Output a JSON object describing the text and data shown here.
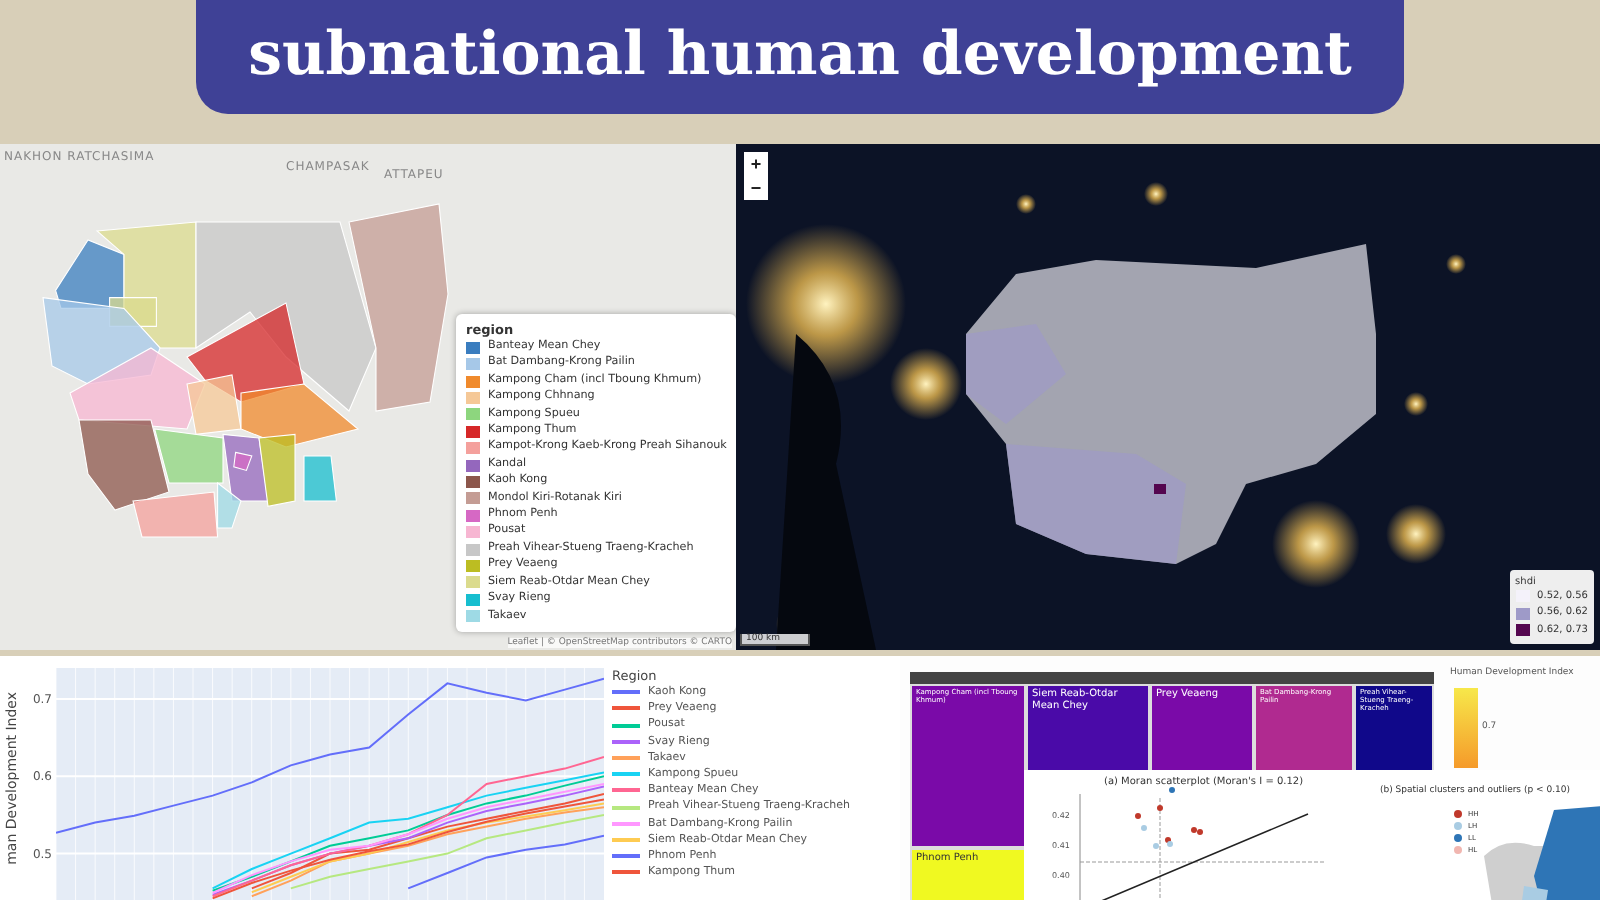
{
  "title": "subnational human development",
  "region_map": {
    "place_labels": [
      "NAKHON RATCHASIMA",
      "CHAMPASAK",
      "ATTAPEU"
    ],
    "legend": {
      "title": "region",
      "items": [
        {
          "label": "Banteay Mean Chey",
          "color": "#3a7dbf"
        },
        {
          "label": "Bat Dambang-Krong Pailin",
          "color": "#a6c8e8"
        },
        {
          "label": "Kampong Cham (incl Tboung Khmum)",
          "color": "#f08a2c"
        },
        {
          "label": "Kampong Chhnang",
          "color": "#f5c897"
        },
        {
          "label": "Kampong Spueu",
          "color": "#8dd67e"
        },
        {
          "label": "Kampong Thum",
          "color": "#d62728"
        },
        {
          "label": "Kampot-Krong Kaeb-Krong Preah Sihanouk",
          "color": "#f4a09c"
        },
        {
          "label": "Kandal",
          "color": "#9467bd"
        },
        {
          "label": "Kaoh Kong",
          "color": "#8c564b"
        },
        {
          "label": "Mondol Kiri-Rotanak Kiri",
          "color": "#c49c94"
        },
        {
          "label": "Phnom Penh",
          "color": "#d668c4"
        },
        {
          "label": "Pousat",
          "color": "#f7b6d2"
        },
        {
          "label": "Preah Vihear-Stueng Traeng-Kracheh",
          "color": "#c7c7c7"
        },
        {
          "label": "Prey Veaeng",
          "color": "#bcbd22"
        },
        {
          "label": "Siem Reab-Otdar Mean Chey",
          "color": "#dbdb8d"
        },
        {
          "label": "Svay Rieng",
          "color": "#17becf"
        },
        {
          "label": "Takaev",
          "color": "#9edae5"
        }
      ]
    },
    "attribution": "Leaflet | © OpenStreetMap contributors © CARTO"
  },
  "night_map": {
    "zoom_in": "+",
    "zoom_out": "−",
    "scale": "100 km",
    "legend": {
      "title": "shdi",
      "items": [
        {
          "label": "0.52, 0.56",
          "color": "#f4f2fa"
        },
        {
          "label": "0.56, 0.62",
          "color": "#9e9ac8"
        },
        {
          "label": "0.62, 0.73",
          "color": "#54064f"
        }
      ]
    }
  },
  "line_chart": {
    "legend_title": "Region",
    "chart_data": {
      "type": "line",
      "ylabel": "man Development Index",
      "ylim": [
        0.44,
        0.74
      ],
      "grid": true,
      "yticks": [
        0.5,
        0.6,
        0.7
      ],
      "series": [
        {
          "name": "Kaoh Kong",
          "color": "#636efa",
          "values": [
            0.527,
            0.54,
            0.549,
            0.562,
            0.575,
            0.592,
            0.614,
            0.628,
            0.637,
            0.68,
            0.72,
            0.708,
            0.698,
            0.712,
            0.726
          ]
        },
        {
          "name": "Prey Veaeng",
          "color": "#ef553b",
          "values": [
            null,
            null,
            null,
            null,
            null,
            0.455,
            0.475,
            0.5,
            0.505,
            0.52,
            0.535,
            0.545,
            0.555,
            0.565,
            0.577
          ]
        },
        {
          "name": "Pousat",
          "color": "#00cc96",
          "values": [
            null,
            null,
            null,
            null,
            0.452,
            0.47,
            0.49,
            0.51,
            0.52,
            0.53,
            0.55,
            0.565,
            0.575,
            0.588,
            0.6
          ]
        },
        {
          "name": "Svay Rieng",
          "color": "#ab63fa",
          "values": [
            null,
            null,
            null,
            null,
            0.447,
            0.465,
            0.485,
            0.5,
            0.51,
            0.52,
            0.54,
            0.555,
            0.565,
            0.575,
            0.587
          ]
        },
        {
          "name": "Takaev",
          "color": "#ffa15a",
          "values": [
            null,
            null,
            null,
            null,
            null,
            0.445,
            0.465,
            0.49,
            0.5,
            0.51,
            0.525,
            0.535,
            0.545,
            0.553,
            0.56
          ]
        },
        {
          "name": "Kampong Spueu",
          "color": "#19d3f3",
          "values": [
            null,
            null,
            null,
            null,
            0.455,
            0.48,
            0.5,
            0.52,
            0.54,
            0.545,
            0.56,
            0.575,
            0.585,
            0.595,
            0.605
          ]
        },
        {
          "name": "Banteay Mean Chey",
          "color": "#ff6692",
          "values": [
            null,
            null,
            null,
            null,
            0.445,
            0.465,
            0.485,
            0.5,
            0.51,
            0.525,
            0.55,
            0.59,
            0.6,
            0.61,
            0.625
          ]
        },
        {
          "name": "Preah Vihear-Stueng Traeng-Kracheh",
          "color": "#b6e880",
          "values": [
            null,
            null,
            null,
            null,
            null,
            null,
            0.455,
            0.47,
            0.48,
            0.49,
            0.5,
            0.52,
            0.53,
            0.54,
            0.55
          ]
        },
        {
          "name": "Bat Dambang-Krong Pailin",
          "color": "#ff97ff",
          "values": [
            null,
            null,
            null,
            null,
            0.449,
            0.472,
            0.49,
            0.505,
            0.51,
            0.525,
            0.545,
            0.56,
            0.57,
            0.58,
            0.59
          ]
        },
        {
          "name": "Siem Reab-Otdar Mean Chey",
          "color": "#fecb52",
          "values": [
            null,
            null,
            null,
            null,
            null,
            0.45,
            0.47,
            0.49,
            0.5,
            0.515,
            0.53,
            0.54,
            0.548,
            0.556,
            0.565
          ]
        },
        {
          "name": "Phnom Penh",
          "color": "#636efa",
          "values": [
            null,
            null,
            null,
            null,
            null,
            null,
            null,
            null,
            null,
            0.455,
            0.475,
            0.495,
            0.505,
            0.512,
            0.523
          ]
        },
        {
          "name": "Kampong Thum",
          "color": "#ef553b",
          "values": [
            null,
            null,
            null,
            null,
            0.442,
            0.462,
            0.478,
            0.492,
            0.503,
            0.512,
            0.528,
            0.541,
            0.552,
            0.561,
            0.57
          ]
        }
      ]
    }
  },
  "treemap": {
    "cells": [
      {
        "label": "Kampong Cham (incl Tboung Khmum)",
        "color": "#7a0aa8"
      },
      {
        "label": "Siem Reab-Otdar Mean Chey",
        "color": "#4a0aa8"
      },
      {
        "label": "Prey Veaeng",
        "color": "#7a0aa8"
      },
      {
        "label": "Bat Dambang-Krong Pailin",
        "color": "#b02a90"
      },
      {
        "label": "Preah Vihear-Stueng Traeng-Kracheh",
        "color": "#10088a"
      },
      {
        "label": "Phnom Penh",
        "color": "#f0f921"
      }
    ],
    "colorbar_title": "Human Development Index",
    "colorbar_tick": "0.7"
  },
  "moran": {
    "title": "(a) Moran scatterplot (Moran's I = 0.12)",
    "y_tick_labels": [
      "0.42",
      "0.41",
      "0.40"
    ],
    "legend": [
      {
        "label": "HH",
        "color": "#c0392b"
      },
      {
        "label": "LH",
        "color": "#a9cce3"
      },
      {
        "label": "LL",
        "color": "#2e75b6"
      },
      {
        "label": "HL",
        "color": "#f1b6b0"
      }
    ],
    "cluster_map_title": "(b) Spatial clusters and outliers (p < 0.10)"
  }
}
